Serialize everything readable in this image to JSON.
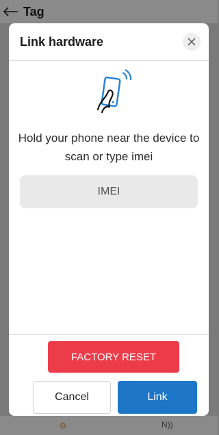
{
  "header": {
    "title": "Tag",
    "back_icon": "arrow-left-icon"
  },
  "modal": {
    "title": "Link hardware",
    "close_icon": "close-icon",
    "illustration_icon": "phone-nfc-tap-icon",
    "instruction": "Hold your phone near the device to scan or type imei",
    "imei_placeholder": "IMEI",
    "imei_value": "",
    "factory_reset_label": "FACTORY RESET",
    "cancel_label": "Cancel",
    "link_label": "Link"
  },
  "colors": {
    "accent_blue": "#1e76c8",
    "danger_red": "#ec3c4a",
    "icon_blue": "#2a83d6",
    "overlay": "#7a7a7a"
  }
}
